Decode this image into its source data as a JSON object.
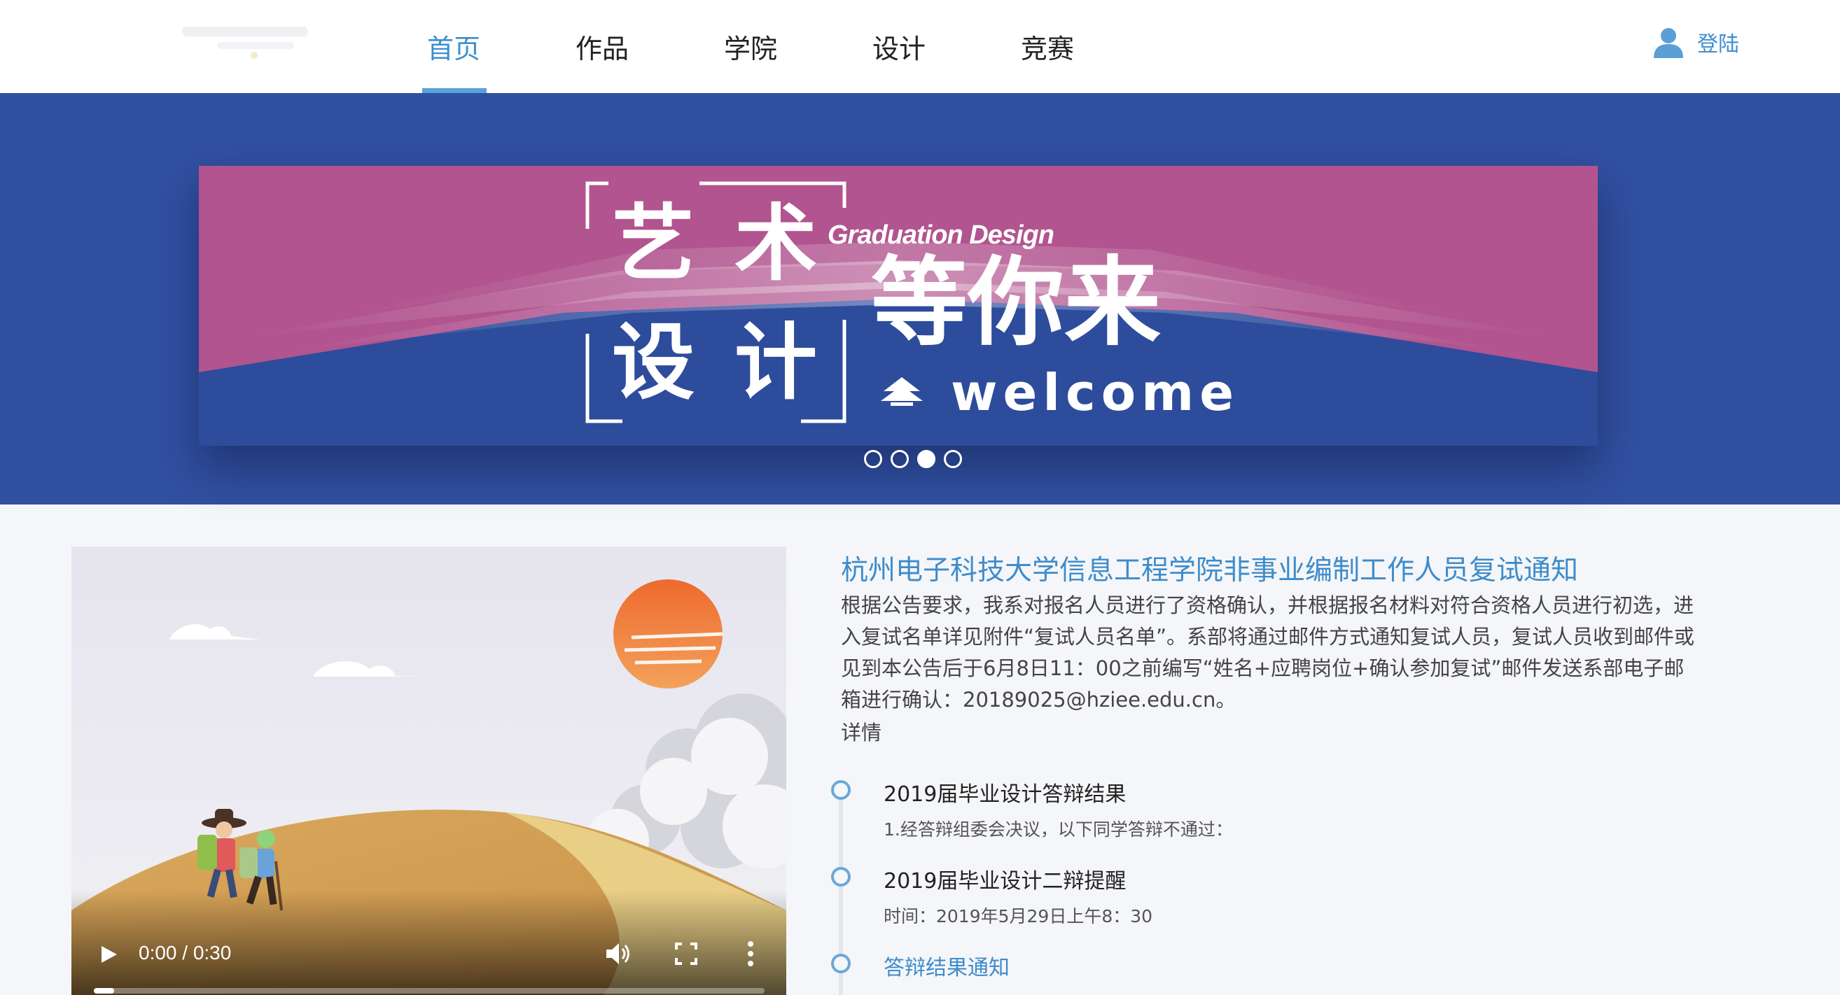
{
  "nav": {
    "items": [
      "首页",
      "作品",
      "学院",
      "设计",
      "竞赛"
    ],
    "active_index": 0,
    "login_label": "登陆"
  },
  "banner": {
    "headline_chars": [
      "艺",
      "术",
      "设",
      "计"
    ],
    "tagline": "Graduation Design",
    "slogan": "等你来",
    "welcome": "welcome",
    "slide_count": 4,
    "active_slide": 2,
    "colors": {
      "backdrop": "#3150a0",
      "magenta": "#b1548f",
      "blue": "#2d4c9c"
    }
  },
  "video": {
    "time_display": "0:00 / 0:30",
    "progress": 0.03
  },
  "news": {
    "title": "杭州电子科技大学信息工程学院非事业编制工作人员复试通知",
    "body": "根据公告要求，我系对报名人员进行了资格确认，并根据报名材料对符合资格人员进行初选，进入复试名单详见附件“复试人员名单”。系部将通过邮件方式通知复试人员，复试人员收到邮件或见到本公告后于6月8日11：00之前编写“姓名+应聘岗位+确认参加复试”邮件发送系部电子邮箱进行确认：20189025@hziee.edu.cn。",
    "more_label": "详情"
  },
  "timeline": [
    {
      "title": "2019届毕业设计答辩结果",
      "desc": "1.经答辩组委会决议，以下同学答辩不通过："
    },
    {
      "title": "2019届毕业设计二辩提醒",
      "desc": "时间：2019年5月29日上午8：30"
    },
    {
      "title": "答辩结果通知",
      "desc": ""
    }
  ]
}
